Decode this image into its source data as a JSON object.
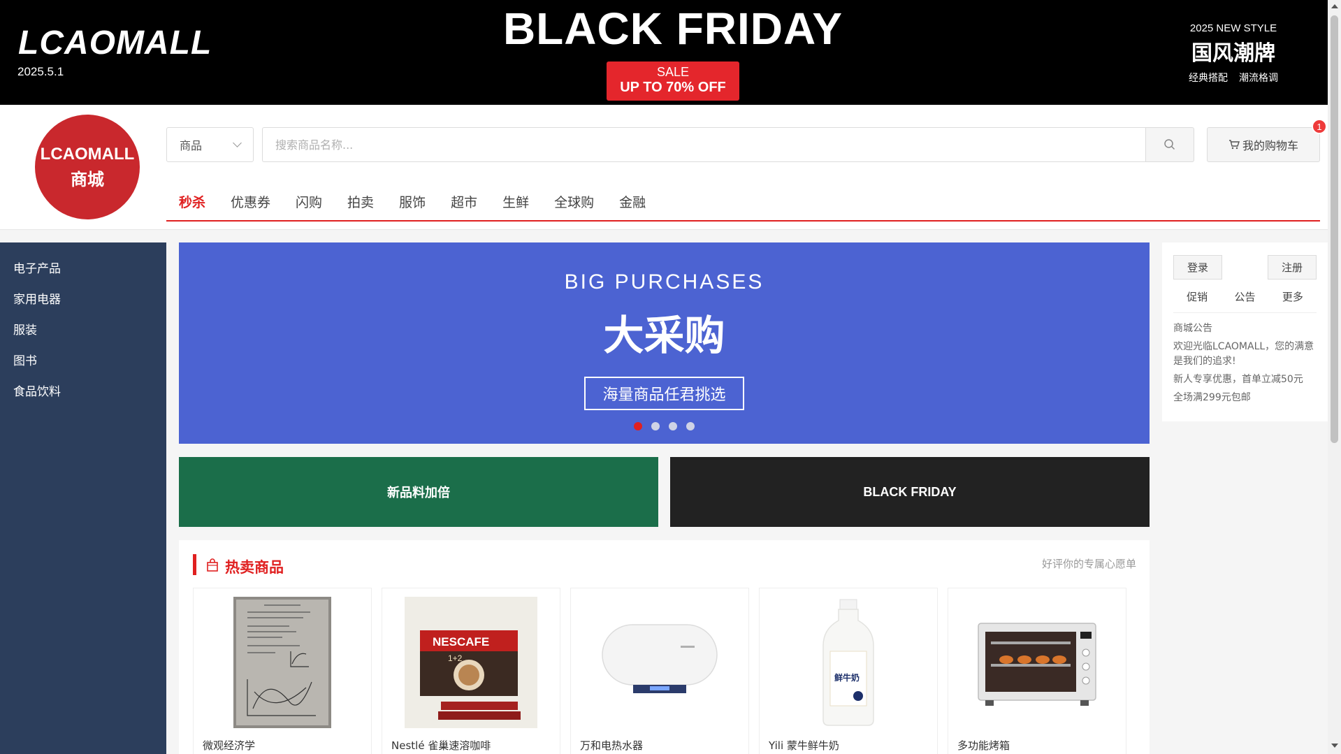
{
  "top_banner": {
    "logo": "LCAOMALL",
    "date": "2025.5.1",
    "title": "BLACK FRIDAY",
    "sale_line1": "SALE",
    "sale_line2": "UP TO 70% OFF",
    "style_line1": "2025 NEW STYLE",
    "style_line2": "国风潮牌",
    "style_tags": [
      "经典搭配",
      "潮流格调"
    ]
  },
  "header": {
    "logo_line1": "LCAOMALL",
    "logo_line2": "商城",
    "search_type": "商品",
    "search_placeholder": "搜索商品名称...",
    "cart_label": "我的购物车",
    "cart_count": "1",
    "nav": [
      "秒杀",
      "优惠券",
      "闪购",
      "拍卖",
      "服饰",
      "超市",
      "生鲜",
      "全球购",
      "金融"
    ]
  },
  "sidebar": {
    "items": [
      "电子产品",
      "家用电器",
      "服装",
      "图书",
      "食品饮料"
    ]
  },
  "carousel": {
    "title_en": "BIG PURCHASES",
    "title_cn": "大采购",
    "button": "海量商品任君挑选",
    "slide_count": 4,
    "active_slide": 1
  },
  "promos": {
    "left": "新品料加倍",
    "right": "BLACK FRIDAY"
  },
  "login_panel": {
    "login": "登录",
    "register": "注册",
    "tabs": [
      "促销",
      "公告",
      "更多"
    ],
    "notices": [
      "商城公告",
      "欢迎光临LCAOMALL，您的满意是我们的追求!",
      "新人专享优惠，首单立减50元",
      "全场满299元包邮"
    ]
  },
  "hot": {
    "title": "热卖商品",
    "link": "好评你的专属心愿单",
    "products": [
      {
        "name": "微观经济学"
      },
      {
        "name": "Nestlé 雀巢速溶咖啡"
      },
      {
        "name": "万和电热水器"
      },
      {
        "name": "Yili 蒙牛鲜牛奶"
      },
      {
        "name": "多功能烤箱"
      }
    ]
  },
  "product_art": {
    "coffee_brand": "NESCAFE",
    "coffee_sub": "1+2",
    "milk_label": "鲜牛奶"
  },
  "colors": {
    "accent_red": "#e02020",
    "sidebar_bg": "#2c3e5c",
    "carousel_bg": "#4c63d2",
    "promo_green": "#1b6e4a",
    "logo_red": "#c9282d"
  }
}
